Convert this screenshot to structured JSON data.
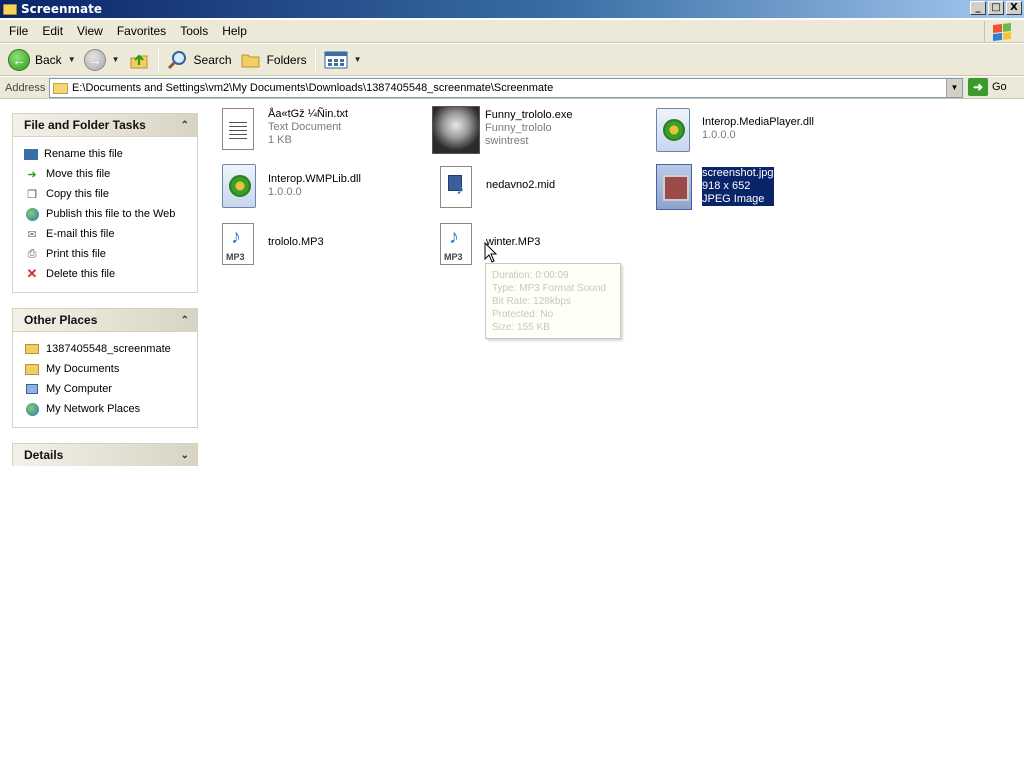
{
  "window": {
    "title": "Screenmate",
    "buttons": {
      "minimize": "_",
      "maximize": "□",
      "close": "X"
    }
  },
  "menu": [
    "File",
    "Edit",
    "View",
    "Favorites",
    "Tools",
    "Help"
  ],
  "toolbar": {
    "back_label": "Back",
    "search_label": "Search",
    "folders_label": "Folders"
  },
  "address": {
    "label": "Address",
    "value": "E:\\Documents and Settings\\vm2\\My Documents\\Downloads\\1387405548_screenmate\\Screenmate",
    "go_label": "Go"
  },
  "left_pane": {
    "file_tasks": {
      "title": "File and Folder Tasks",
      "items": [
        "Rename this file",
        "Move this file",
        "Copy this file",
        "Publish this file to the Web",
        "E-mail this file",
        "Print this file",
        "Delete this file"
      ]
    },
    "other_places": {
      "title": "Other Places",
      "items": [
        "1387405548_screenmate",
        "My Documents",
        "My Computer",
        "My Network Places"
      ]
    },
    "details": {
      "title": "Details"
    }
  },
  "files": [
    {
      "name": "Åa«tGž ¼Ñin.txt",
      "line2": "Text Document",
      "line3": "1 KB",
      "icon": "text-file-icon"
    },
    {
      "name": "Funny_trololo.exe",
      "line2": "Funny_trololo",
      "line3": "swintrest",
      "icon": "exe-thumbnail-icon"
    },
    {
      "name": "Interop.MediaPlayer.dll",
      "line2": "1.0.0.0",
      "line3": "",
      "icon": "dll-icon"
    },
    {
      "name": "Interop.WMPLib.dll",
      "line2": "1.0.0.0",
      "line3": "",
      "icon": "dll-icon"
    },
    {
      "name": "nedavno2.mid",
      "line2": "",
      "line3": "",
      "icon": "midi-icon"
    },
    {
      "name": "screenshot.jpg",
      "line2": "918 x 652",
      "line3": "JPEG Image",
      "icon": "jpeg-icon"
    },
    {
      "name": "trololo.MP3",
      "line2": "",
      "line3": "",
      "icon": "mp3-icon"
    },
    {
      "name": "winter.MP3",
      "line2": "",
      "line3": "",
      "icon": "mp3-icon"
    }
  ],
  "tooltip": {
    "lines": [
      "Duration: 0:00:09",
      "Type: MP3 Format Sound",
      "Bit Rate: 128kbps",
      "Protected: No",
      "Size: 155 KB"
    ]
  },
  "mp3_badge": "MP3"
}
